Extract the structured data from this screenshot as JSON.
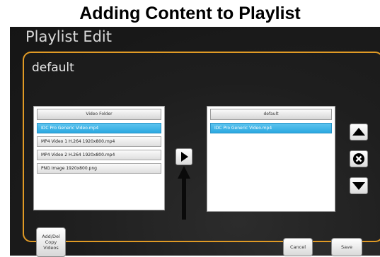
{
  "caption": "Adding Content to Playlist",
  "screen": {
    "title": "Playlist Edit",
    "playlist_name": "default"
  },
  "source_list": {
    "header": "Video Folder",
    "items": [
      {
        "label": "IDC Pro Generic Video.mp4",
        "selected": true
      },
      {
        "label": "MP4 Video 1 H.264 1920x800.mp4",
        "selected": false
      },
      {
        "label": "MP4 Video 2 H.264 1920x800.mp4",
        "selected": false
      },
      {
        "label": "PNG Image 1920x800.png",
        "selected": false
      }
    ]
  },
  "playlist_list": {
    "header": "default",
    "items": [
      {
        "label": "IDC Pro Generic Video.mp4",
        "selected": true
      }
    ]
  },
  "buttons": {
    "add_del_line1": "Add/Del",
    "add_del_line2": "Copy",
    "add_del_line3": "Videos",
    "cancel": "Cancel",
    "save": "Save"
  },
  "icons": {
    "add_arrow": "play-right-icon",
    "move_up": "triangle-up-icon",
    "remove": "x-circle-icon",
    "move_down": "triangle-down-icon",
    "callout": "up-arrow-icon"
  },
  "colors": {
    "accent": "#e09a25",
    "selection": "#2ba8e0"
  }
}
